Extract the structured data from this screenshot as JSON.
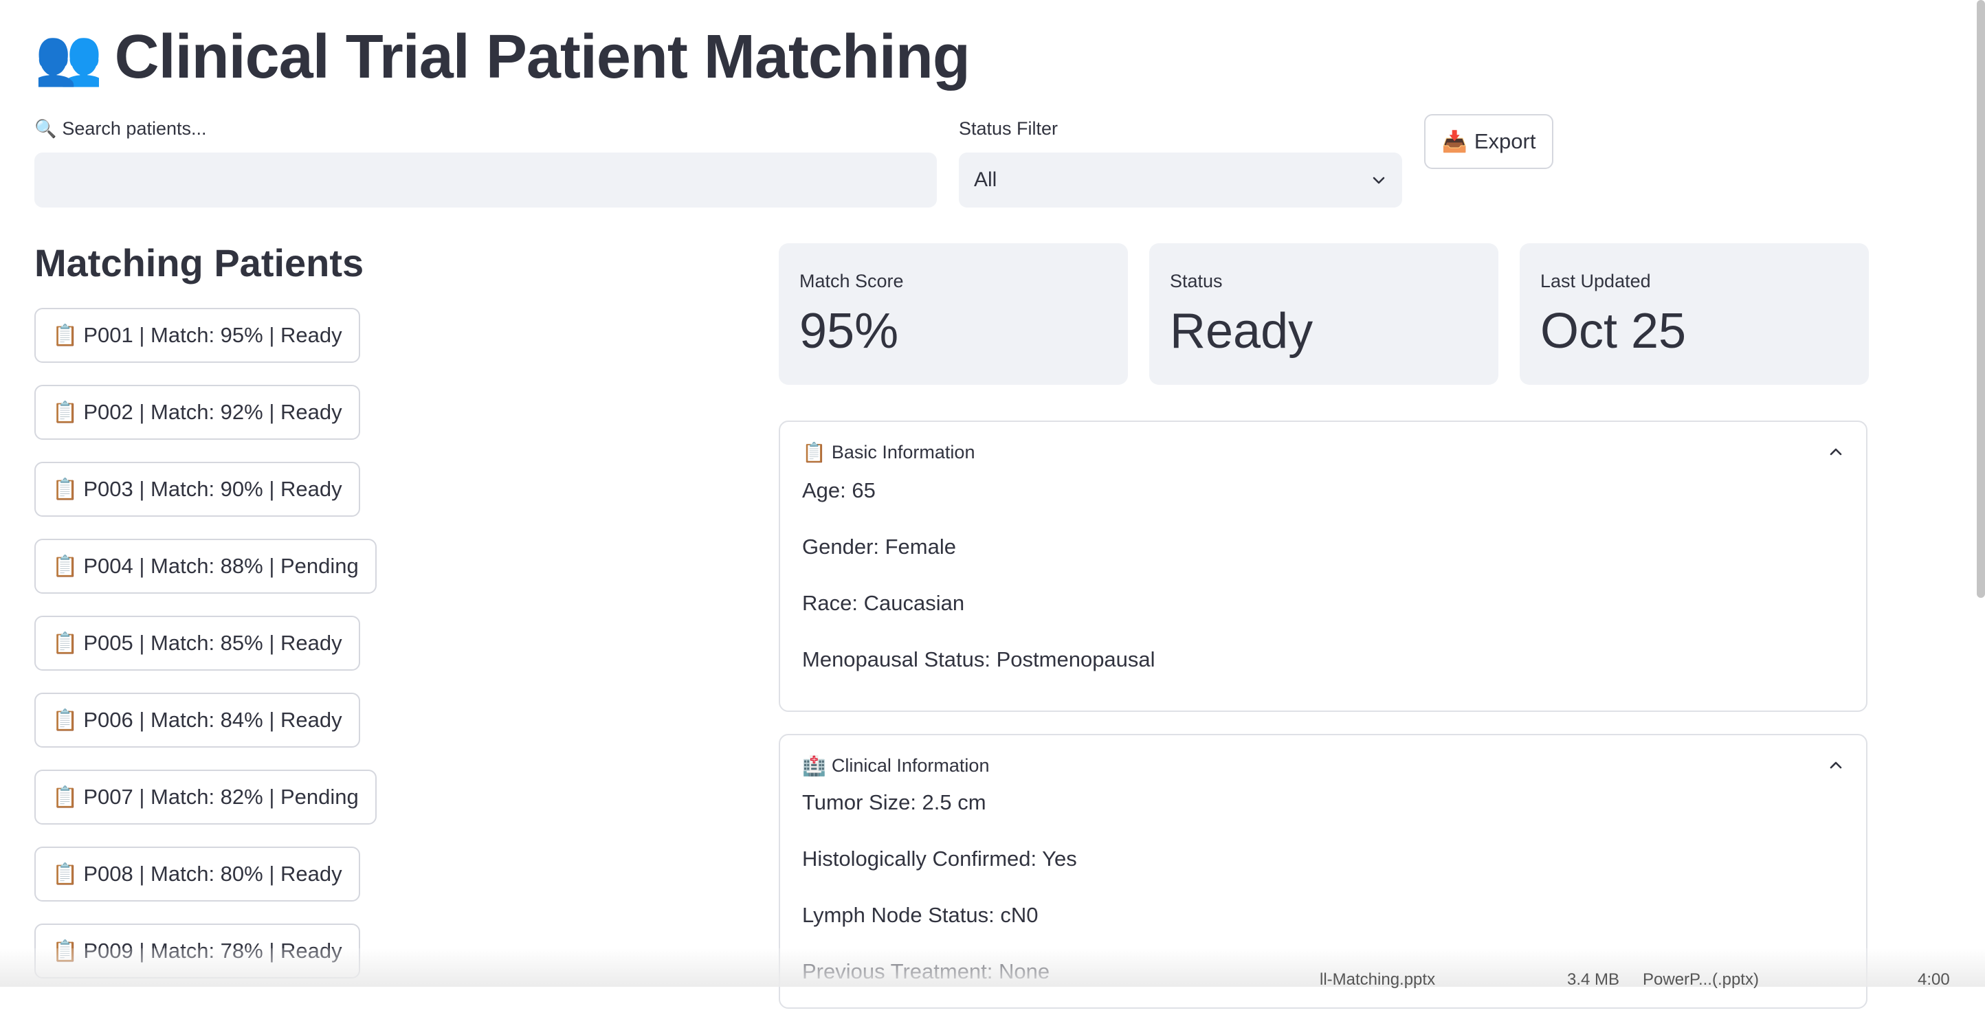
{
  "header": {
    "icon": "👥",
    "title": "Clinical Trial Patient Matching"
  },
  "search": {
    "icon": "🔍",
    "label": "Search patients...",
    "value": ""
  },
  "status_filter": {
    "label": "Status Filter",
    "selected": "All"
  },
  "export": {
    "icon": "📥",
    "label": "Export"
  },
  "list": {
    "title": "Matching Patients",
    "icon": "📋",
    "items": [
      "P001 | Match: 95% | Ready",
      "P002 | Match: 92% | Ready",
      "P003 | Match: 90% | Ready",
      "P004 | Match: 88% | Pending",
      "P005 | Match: 85% | Ready",
      "P006 | Match: 84% | Ready",
      "P007 | Match: 82% | Pending",
      "P008 | Match: 80% | Ready",
      "P009 | Match: 78% | Ready"
    ]
  },
  "metrics": [
    {
      "label": "Match Score",
      "value": "95%"
    },
    {
      "label": "Status",
      "value": "Ready"
    },
    {
      "label": "Last Updated",
      "value": "Oct 25"
    }
  ],
  "basic_info": {
    "icon": "📋",
    "title": "Basic Information",
    "rows": [
      "Age: 65",
      "Gender: Female",
      "Race: Caucasian",
      "Menopausal Status: Postmenopausal"
    ]
  },
  "clinical_info": {
    "icon": "🏥",
    "title": "Clinical Information",
    "rows": [
      "Tumor Size: 2.5 cm",
      "Histologically Confirmed: Yes",
      "Lymph Node Status: cN0",
      "Previous Treatment: None"
    ]
  },
  "taskbar": {
    "file": "ll-Matching.pptx",
    "size": "3.4 MB",
    "app": "PowerP...(.pptx)",
    "time": "4:00"
  },
  "colors": {
    "text": "#31333f",
    "field_bg": "#f0f2f6",
    "border": "#d5d7de"
  }
}
